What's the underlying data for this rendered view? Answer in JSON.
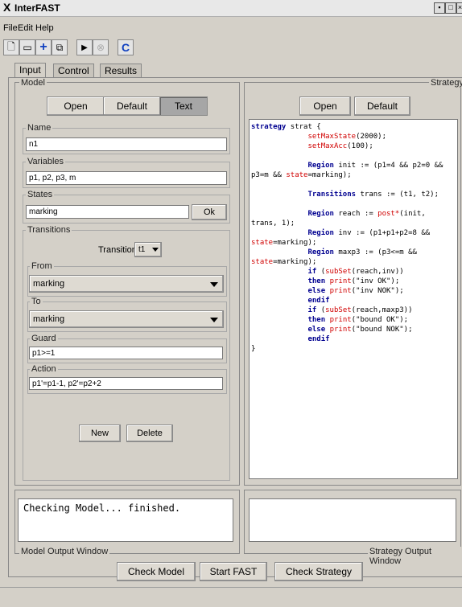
{
  "window": {
    "title": "InterFAST"
  },
  "menu": {
    "file": "File",
    "edit": "Edit",
    "help": "Help"
  },
  "tabs": {
    "input": "Input",
    "control": "Control",
    "results": "Results"
  },
  "model": {
    "title": "Model",
    "open": "Open",
    "default": "Default",
    "text": "Text",
    "name_label": "Name",
    "name_value": "n1",
    "variables_label": "Variables",
    "variables_value": "p1, p2, p3, m",
    "states_label": "States",
    "states_value": "marking",
    "ok": "Ok",
    "transitions_label": "Transitions",
    "transition_label": "Transition :",
    "transition_value": "t1",
    "from_label": "From",
    "from_value": "marking",
    "to_label": "To",
    "to_value": "marking",
    "guard_label": "Guard",
    "guard_value": "p1>=1",
    "action_label": "Action",
    "action_value": "p1'=p1-1, p2'=p2+2",
    "new": "New",
    "delete": "Delete"
  },
  "strategy": {
    "title": "Strategy",
    "open": "Open",
    "default": "Default"
  },
  "output": {
    "model_text": "Checking Model... finished.",
    "model_label": "Model Output Window",
    "strategy_label": "Strategy Output Window"
  },
  "bottom": {
    "check_model": "Check Model",
    "start_fast": "Start FAST",
    "check_strategy": "Check Strategy"
  },
  "icons": [
    "new-file-icon",
    "open-folder-icon",
    "add-icon",
    "copy-icon",
    "play-icon",
    "stop-icon",
    "refresh-c-icon"
  ]
}
